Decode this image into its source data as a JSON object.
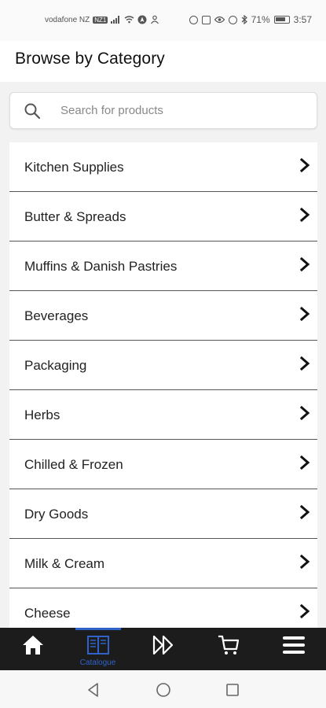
{
  "status_bar": {
    "carrier": "vodafone NZ",
    "carrier_badge": "NZ1",
    "battery": "71%",
    "time": "3:57"
  },
  "header": {
    "title": "Browse by Category"
  },
  "search": {
    "placeholder": "Search for products",
    "value": ""
  },
  "categories": [
    {
      "label": "Kitchen Supplies"
    },
    {
      "label": "Butter & Spreads"
    },
    {
      "label": "Muffins & Danish Pastries"
    },
    {
      "label": "Beverages"
    },
    {
      "label": "Packaging"
    },
    {
      "label": "Herbs"
    },
    {
      "label": "Chilled & Frozen"
    },
    {
      "label": "Dry Goods"
    },
    {
      "label": "Milk & Cream"
    },
    {
      "label": "Cheese"
    }
  ],
  "bottom_nav": {
    "items": [
      {
        "icon": "home-icon",
        "label": ""
      },
      {
        "icon": "book-icon",
        "label": "Catalogue",
        "active": true
      },
      {
        "icon": "fast-forward-icon",
        "label": ""
      },
      {
        "icon": "cart-icon",
        "label": ""
      },
      {
        "icon": "menu-icon",
        "label": ""
      }
    ],
    "active_color": "#2f63c9",
    "background": "#1c1c1c"
  },
  "system_nav": {
    "buttons": [
      "back-icon",
      "home-circle-icon",
      "recents-icon"
    ]
  }
}
